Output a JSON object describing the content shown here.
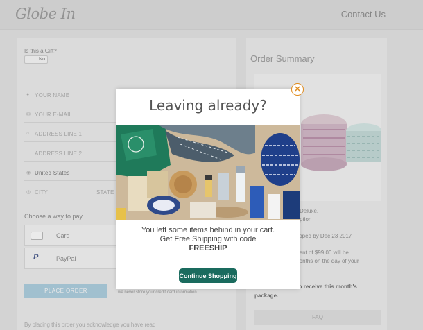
{
  "header": {
    "logo": "Globe In",
    "contact_link": "Contact Us"
  },
  "checkout": {
    "gift_label": "Is this a Gift?",
    "gift_toggle": "No",
    "fields": {
      "name": "YOUR NAME",
      "email": "YOUR E-MAIL",
      "address1": "ADDRESS LINE 1",
      "address2": "ADDRESS LINE 2",
      "country": "United States",
      "city": "CITY",
      "state": "STATE"
    },
    "payment_label": "Choose a way to pay",
    "payment_options": [
      "Card",
      "PayPal"
    ],
    "place_order": "PLACE ORDER",
    "secure_note": "we never store your credit card information.",
    "acknowledge": "By placing this order you acknowledge you have read"
  },
  "order_summary": {
    "title": "Order Summary",
    "line1": "Deluxe.",
    "line2": "ption",
    "line3": "hipped by Dec 23 2017",
    "line4": "ment of $99.00 will be",
    "line5": "months on the day of your",
    "bold_line1": "to receive this month's",
    "bold_line2": "package.",
    "faq": "FAQ"
  },
  "modal": {
    "title": "Leaving already?",
    "message_line1": "You left some items behind in your cart.",
    "message_line2": "Get Free Shipping with code",
    "code": "FREESHIP",
    "button": "Continue Shopping",
    "close_icon": "close-icon",
    "accent_color": "#1a6b5e"
  }
}
